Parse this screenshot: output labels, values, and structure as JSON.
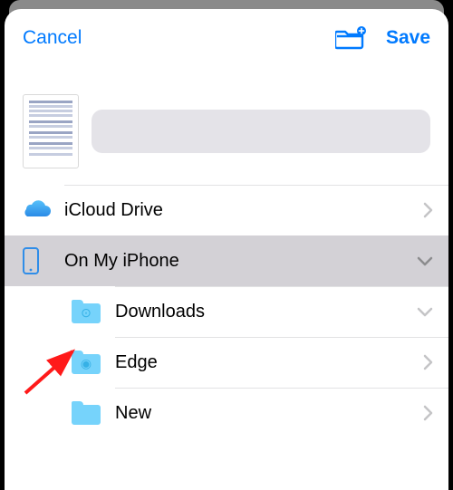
{
  "nav": {
    "cancel": "Cancel",
    "save": "Save"
  },
  "filename": {
    "value": "",
    "placeholder": ""
  },
  "locations": [
    {
      "id": "icloud",
      "label": "iCloud Drive",
      "icon": "icloud",
      "selected": false,
      "disclosure": "right"
    },
    {
      "id": "onmyiphone",
      "label": "On My iPhone",
      "icon": "iphone",
      "selected": true,
      "disclosure": "down"
    }
  ],
  "subfolders": [
    {
      "id": "downloads",
      "label": "Downloads",
      "glyph": "↓",
      "disclosure": "down"
    },
    {
      "id": "edge",
      "label": "Edge",
      "glyph": "◎",
      "disclosure": "right"
    },
    {
      "id": "new",
      "label": "New",
      "glyph": "",
      "disclosure": "right"
    }
  ],
  "colors": {
    "accent": "#007aff",
    "folder": "#76d3fb",
    "selectedRow": "#d3d1d6"
  }
}
